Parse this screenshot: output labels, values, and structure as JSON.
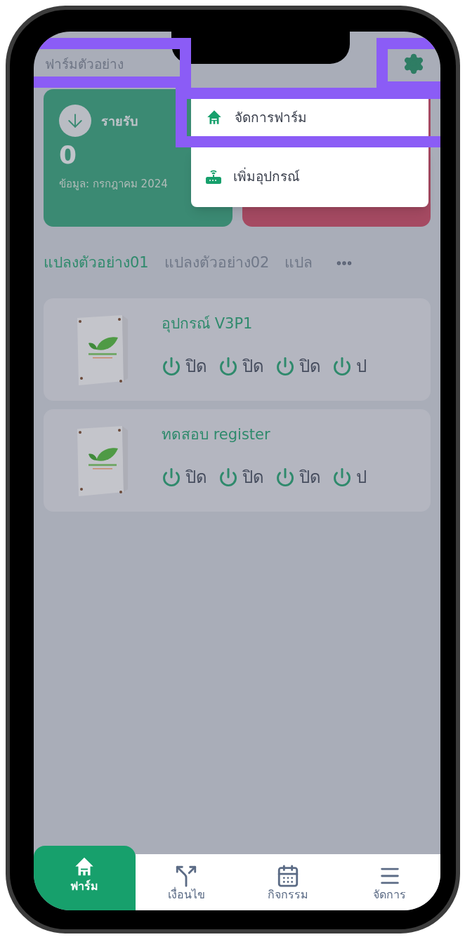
{
  "header": {
    "title": "ฟาร์มตัวอย่าง"
  },
  "summary_cards": [
    {
      "kind": "income",
      "label": "รายรับ",
      "value": "0",
      "note": "ข้อมูล: กรกฎาคม 2024"
    },
    {
      "kind": "expense"
    }
  ],
  "dropdown_menu": [
    {
      "kind": "farm",
      "label": "จัดการฟาร์ม"
    },
    {
      "kind": "device",
      "label": "เพิ่มอุปกรณ์"
    }
  ],
  "plot_tabs": [
    {
      "label": "แปลงตัวอย่าง01",
      "selected": true
    },
    {
      "label": "แปลงตัวอย่าง02",
      "selected": false
    },
    {
      "label": "แปล",
      "selected": false
    }
  ],
  "devices": [
    {
      "name": "อุปกรณ์ V3P1",
      "switches": [
        {
          "label": "ปิด"
        },
        {
          "label": "ปิด"
        },
        {
          "label": "ปิด"
        },
        {
          "label": "ป"
        }
      ]
    },
    {
      "name": "ทดสอบ register",
      "switches": [
        {
          "label": "ปิด"
        },
        {
          "label": "ปิด"
        },
        {
          "label": "ปิด"
        },
        {
          "label": "ป"
        }
      ]
    }
  ],
  "bottom_nav": [
    {
      "kind": "farm",
      "label": "ฟาร์ม",
      "selected": true
    },
    {
      "kind": "conditions",
      "label": "เงื่อนไข",
      "selected": false
    },
    {
      "kind": "activity",
      "label": "กิจกรรม",
      "selected": false
    },
    {
      "kind": "menu",
      "label": "จัดการ",
      "selected": false
    }
  ]
}
